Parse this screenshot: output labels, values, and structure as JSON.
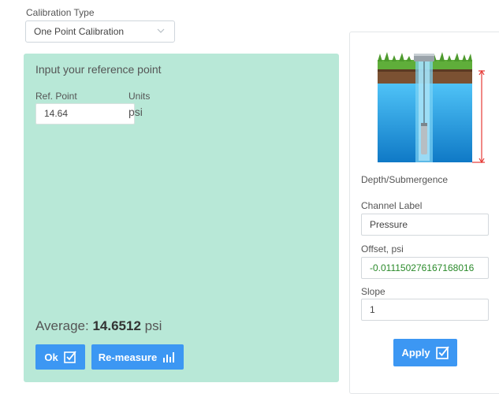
{
  "calibration": {
    "label": "Calibration Type",
    "selected": "One Point Calibration"
  },
  "panel": {
    "title": "Input your reference point",
    "ref_label": "Ref. Point",
    "ref_value": "14.64",
    "units_label": "Units",
    "units_value": "psi",
    "average_label": "Average:",
    "average_value": "14.6512",
    "average_unit": "psi",
    "ok_label": "Ok",
    "remeasure_label": "Re-measure"
  },
  "card": {
    "depth_label": "Depth/Submergence",
    "channel_label": "Channel Label",
    "channel_value": "Pressure",
    "offset_label": "Offset, psi",
    "offset_value": "-0.011150276167168016",
    "slope_label": "Slope",
    "slope_value": "1",
    "apply_label": "Apply"
  },
  "colors": {
    "panel_bg": "#b8e8d7",
    "button_bg": "#3c97f3",
    "offset_text": "#2a8a2a",
    "depth_marker": "#e53935"
  },
  "icons": [
    "chevron-down-icon",
    "checkbox-icon",
    "bar-chart-icon",
    "well-sensor-illustration"
  ]
}
